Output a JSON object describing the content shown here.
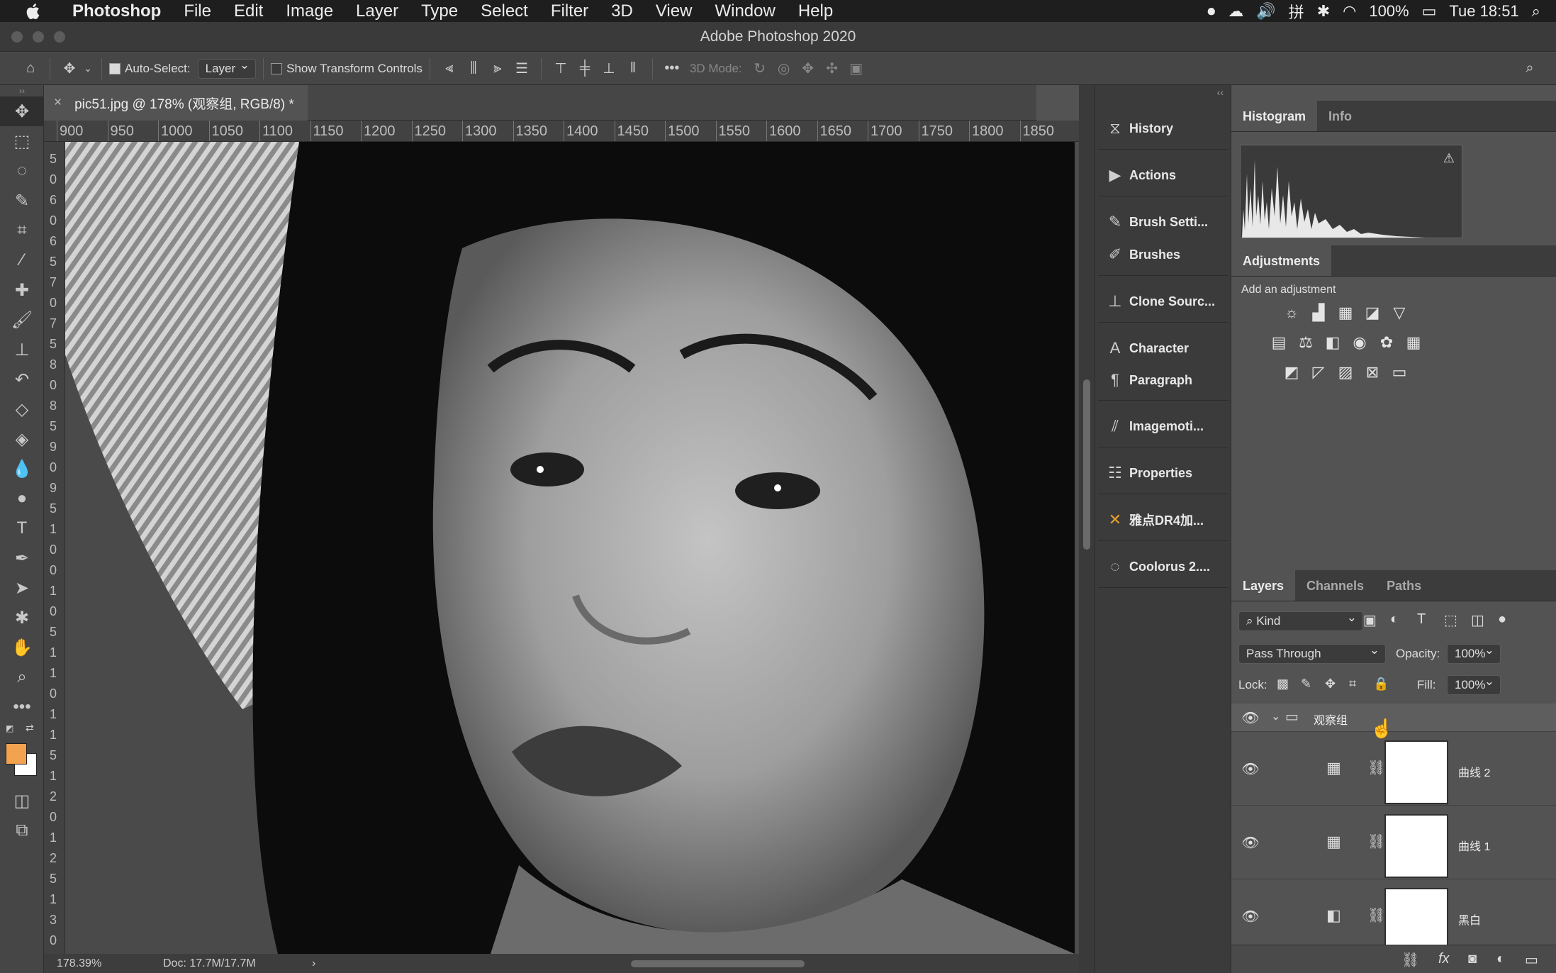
{
  "menubar": {
    "app": "Photoshop",
    "items": [
      "File",
      "Edit",
      "Image",
      "Layer",
      "Type",
      "Select",
      "Filter",
      "3D",
      "View",
      "Window",
      "Help"
    ],
    "battery": "100%",
    "clock": "Tue 18:51",
    "input_method": "拼"
  },
  "titlebar": {
    "title": "Adobe Photoshop 2020"
  },
  "options": {
    "auto_select_label": "Auto-Select:",
    "auto_select_checked": true,
    "auto_select_value": "Layer",
    "show_transform_label": "Show Transform Controls",
    "show_transform_checked": false,
    "mode3d_label": "3D Mode:"
  },
  "document": {
    "tab_title": "pic51.jpg @ 178% (观察组, RGB/8) *",
    "zoom": "178.39%",
    "doc_size": "Doc: 17.7M/17.7M"
  },
  "ruler": {
    "h_ticks": [
      "900",
      "950",
      "1000",
      "1050",
      "1100",
      "1150",
      "1200",
      "1250",
      "1300",
      "1350",
      "1400",
      "1450",
      "1500",
      "1550",
      "1600",
      "1650",
      "1700",
      "1750",
      "1800",
      "1850"
    ],
    "v_ticks": [
      "5",
      "0",
      "6",
      "0",
      "6",
      "5",
      "7",
      "0",
      "7",
      "5",
      "8",
      "0",
      "8",
      "5",
      "9",
      "0",
      "9",
      "5",
      "1",
      "0",
      "0",
      "1",
      "0",
      "5",
      "1",
      "1",
      "0",
      "1",
      "1",
      "5",
      "1",
      "2",
      "0",
      "1",
      "2",
      "5",
      "1",
      "3",
      "0"
    ]
  },
  "dock": {
    "items": [
      {
        "label": "History",
        "icon": "history-icon"
      },
      {
        "label": "Actions",
        "icon": "play-icon"
      },
      {
        "label": "Brush Setti...",
        "icon": "brush-settings-icon"
      },
      {
        "label": "Brushes",
        "icon": "brushes-icon"
      },
      {
        "label": "Clone Sourc...",
        "icon": "clone-source-icon"
      },
      {
        "label": "Character",
        "icon": "character-icon"
      },
      {
        "label": "Paragraph",
        "icon": "paragraph-icon"
      },
      {
        "label": "Imagemoti...",
        "icon": "imagemotion-icon"
      },
      {
        "label": "Properties",
        "icon": "properties-icon"
      },
      {
        "label": "雅点DR4加...",
        "icon": "dr4-plugin-icon"
      },
      {
        "label": "Coolorus 2....",
        "icon": "coolorus-icon"
      }
    ]
  },
  "histogram": {
    "tabs": [
      "Histogram",
      "Info"
    ]
  },
  "adjustments": {
    "title": "Adjustments",
    "subtitle": "Add an adjustment"
  },
  "layers_panel": {
    "tabs": [
      "Layers",
      "Channels",
      "Paths"
    ],
    "filter_kind": "Kind",
    "blend_mode": "Pass Through",
    "opacity_label": "Opacity:",
    "opacity": "100%",
    "lock_label": "Lock:",
    "fill_label": "Fill:",
    "fill": "100%",
    "layers": [
      {
        "name": "观察组",
        "type": "group"
      },
      {
        "name": "曲线 2",
        "type": "curves"
      },
      {
        "name": "曲线 1",
        "type": "curves"
      },
      {
        "name": "黑白",
        "type": "black-white"
      }
    ]
  },
  "colors": {
    "foreground": "#f3a34f",
    "background": "#ffffff",
    "accent": "#d68a2e"
  }
}
